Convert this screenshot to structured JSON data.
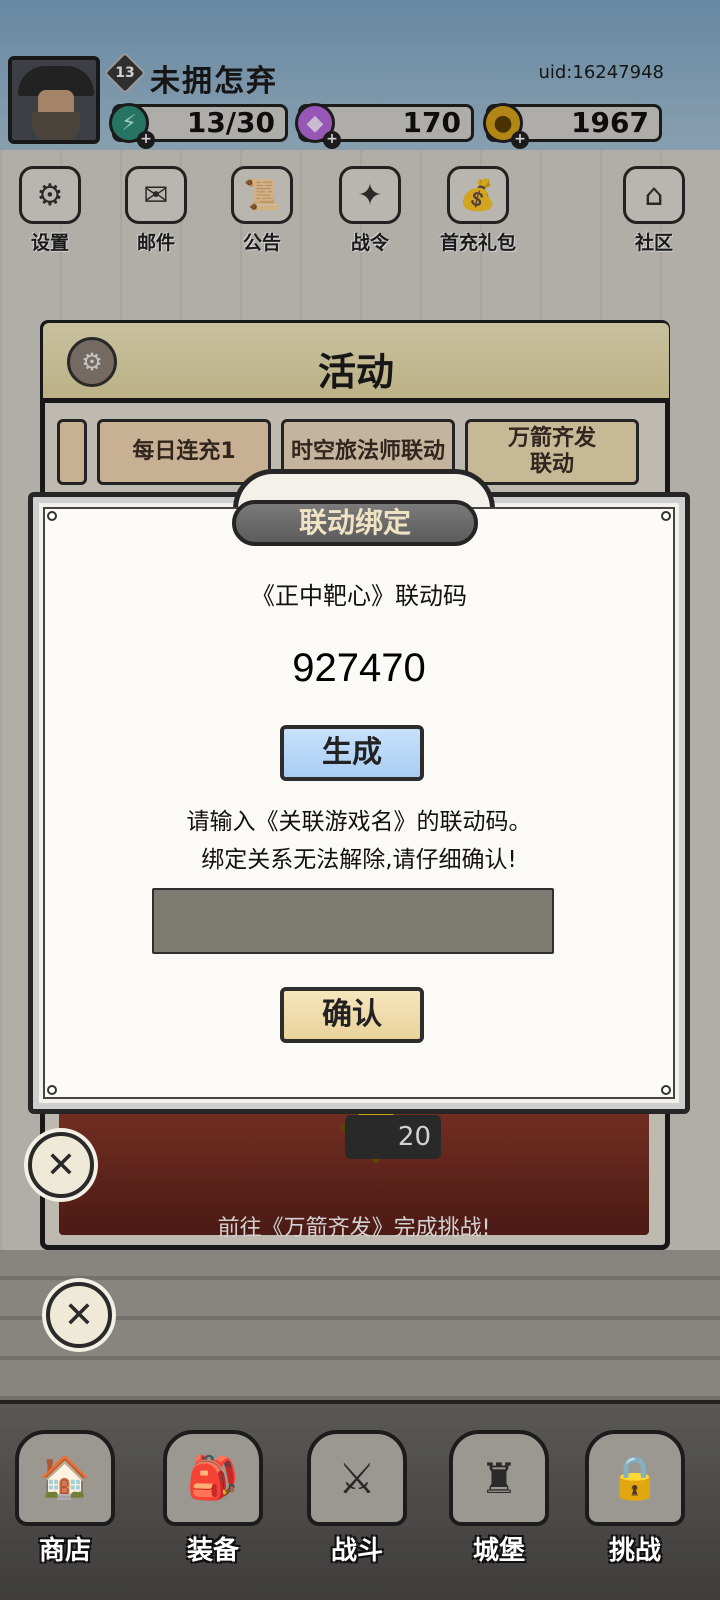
{
  "header": {
    "level": "13",
    "player_name": "未拥怎弃",
    "uid": "uid:16247948",
    "energy": "13/30",
    "gems": "170",
    "coins": "1967"
  },
  "top_icons": [
    {
      "label": "设置",
      "icon": "gear-icon"
    },
    {
      "label": "邮件",
      "icon": "mail-icon"
    },
    {
      "label": "公告",
      "icon": "scroll-icon"
    },
    {
      "label": "战令",
      "icon": "crystal-ball-icon"
    },
    {
      "label": "首充礼包",
      "icon": "pouch-icon"
    },
    {
      "label": "社区",
      "icon": "home-icon"
    }
  ],
  "activity_panel": {
    "title": "活动",
    "tabs": [
      "每日连充1",
      "时空旅法师联动",
      "万箭齐发\n联动"
    ],
    "banner_count": "20",
    "banner_text": "前往《万箭齐发》完成挑战!"
  },
  "bind_dialog": {
    "title": "联动绑定",
    "code_label": "《正中靶心》联动码",
    "code_value": "927470",
    "generate_label": "生成",
    "hint_line1": "请输入《关联游戏名》的联动码。",
    "hint_line2": "绑定关系无法解除,请仔细确认!",
    "input_value": "",
    "confirm_label": "确认"
  },
  "bottom_nav": [
    {
      "label": "商店",
      "icon": "shop-icon"
    },
    {
      "label": "装备",
      "icon": "backpack-icon"
    },
    {
      "label": "战斗",
      "icon": "crossed-swords-icon"
    },
    {
      "label": "城堡",
      "icon": "castle-icon"
    },
    {
      "label": "挑战",
      "icon": "lock-icon"
    }
  ],
  "colors": {
    "generate_button": "#b8d7f6",
    "confirm_button": "#f0dcab",
    "input_bg": "#7e7b73",
    "panel_header": "#ede1b0"
  }
}
